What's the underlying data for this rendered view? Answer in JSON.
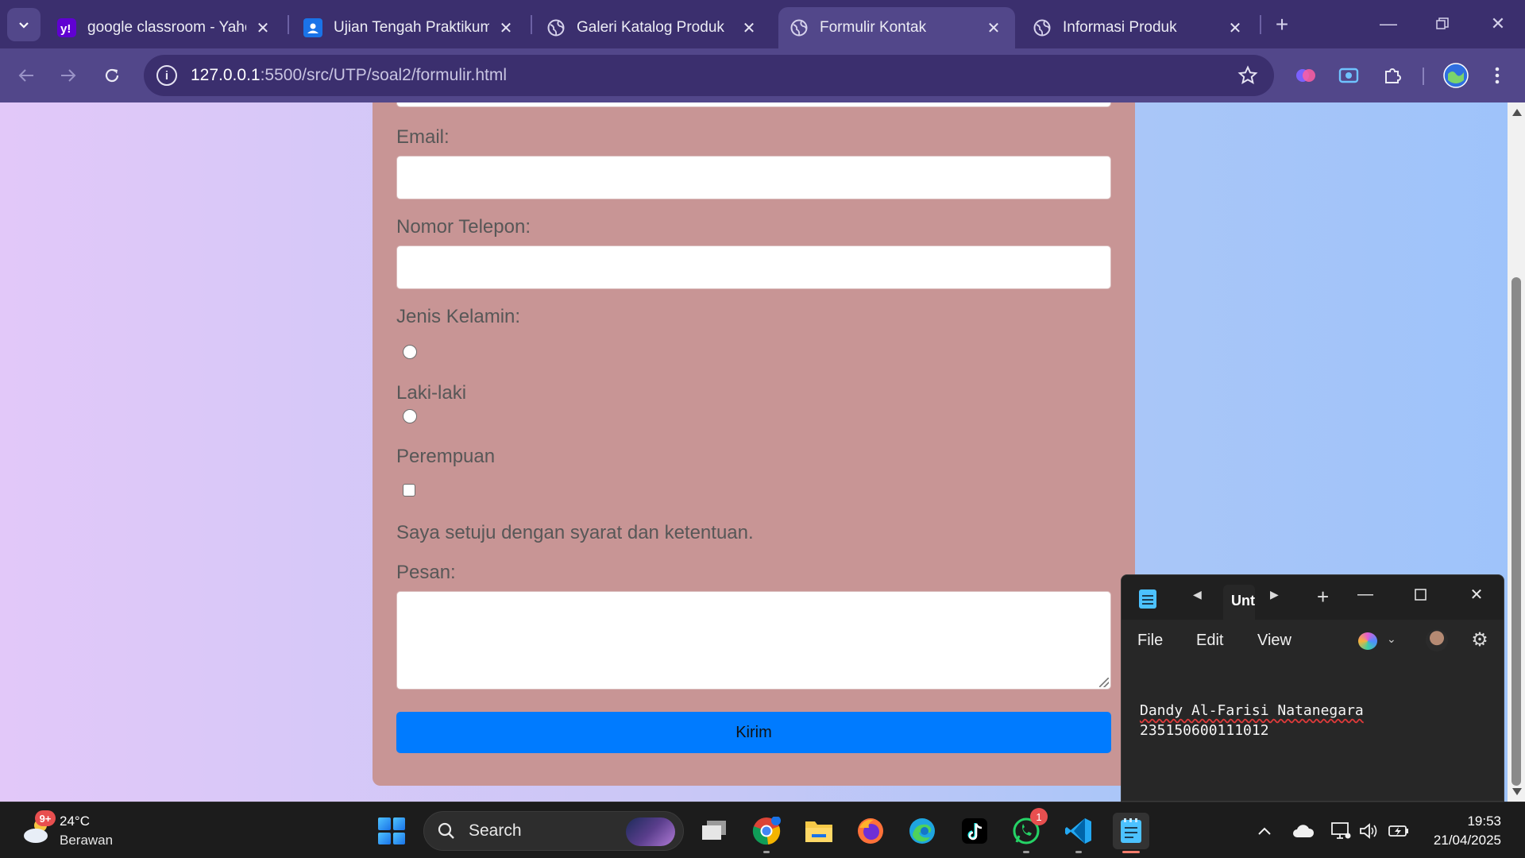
{
  "browser": {
    "tabs": [
      {
        "title": "google classroom - Yahoo Search Results",
        "icon": "yahoo-icon",
        "active": false
      },
      {
        "title": "Ujian Tengah Praktikum Pemrograman Web",
        "icon": "classroom-icon",
        "active": false
      },
      {
        "title": "Galeri Katalog Produk",
        "icon": "globe-icon",
        "active": false
      },
      {
        "title": "Formulir Kontak",
        "icon": "globe-icon",
        "active": true
      },
      {
        "title": "Informasi Produk",
        "icon": "globe-icon",
        "active": false
      }
    ],
    "url_host": "127.0.0.1",
    "url_rest": ":5500/src/UTP/soal2/formulir.html"
  },
  "form": {
    "email_label": "Email:",
    "phone_label": "Nomor Telepon:",
    "gender_label": "Jenis Kelamin:",
    "gender_options": [
      "Laki-laki",
      "Perempuan"
    ],
    "terms_label": "Saya setuju dengan syarat dan ketentuan.",
    "message_label": "Pesan:",
    "submit_label": "Kirim",
    "card_color": "#c89595",
    "button_color": "#007bff"
  },
  "notepad": {
    "tab_title": "Untitled",
    "menu": [
      "File",
      "Edit",
      "View"
    ],
    "content_line1": "Dandy Al-Farisi Natanegara",
    "content_line2": "235150600111012"
  },
  "taskbar": {
    "weather_badge": "9+",
    "weather_temp": "24°C",
    "weather_condition": "Berawan",
    "search_placeholder": "Search",
    "apps": [
      "task-view",
      "chrome",
      "file-explorer",
      "firefox",
      "edge",
      "tiktok",
      "whatsapp",
      "vscode",
      "notepad"
    ],
    "whatsapp_badge": "1",
    "time": "19:53",
    "date": "21/04/2025"
  }
}
